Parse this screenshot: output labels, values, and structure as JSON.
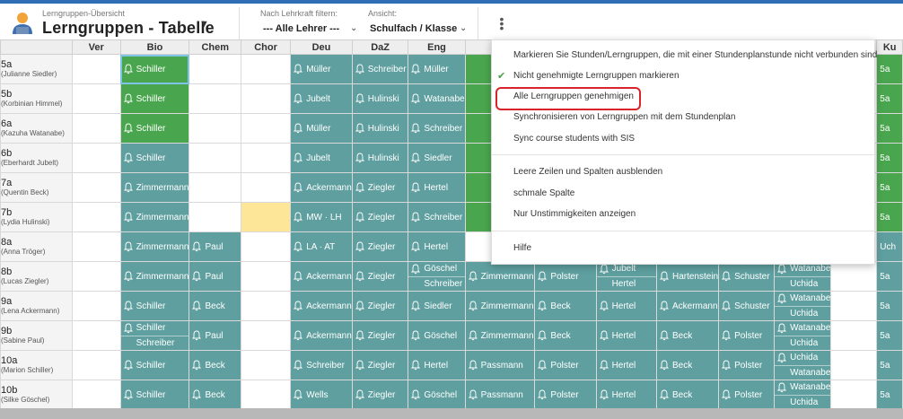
{
  "header": {
    "subtitle": "Lerngruppen-Übersicht",
    "title": "Lerngruppen - Tabelle",
    "filter_teacher_label": "Nach Lehrkraft filtern:",
    "filter_teacher_value": "--- Alle Lehrer ---",
    "view_label": "Ansicht:",
    "view_value": "Schulfach / Klasse"
  },
  "columns": [
    "",
    "Ver",
    "Bio",
    "Chem",
    "Chor",
    "Deu",
    "DaZ",
    "Eng",
    "",
    "",
    "",
    "",
    "",
    "",
    "",
    "Ku"
  ],
  "colors": {
    "teal": "#5f9f9f",
    "green": "#4aa64e",
    "yellow": "#fde698",
    "accent": "#2f6db5",
    "highlight": "#d9252a"
  },
  "rows": [
    {
      "cls": "5a",
      "teacher": "(Julianne Siedler)"
    },
    {
      "cls": "5b",
      "teacher": "(Korbinian Himmel)"
    },
    {
      "cls": "6a",
      "teacher": "(Kazuha Watanabe)"
    },
    {
      "cls": "6b",
      "teacher": "(Eberhardt Jubelt)"
    },
    {
      "cls": "7a",
      "teacher": "(Quentin Beck)"
    },
    {
      "cls": "7b",
      "teacher": "(Lydia Hulinski)"
    },
    {
      "cls": "8a",
      "teacher": "(Anna Tröger)"
    },
    {
      "cls": "8b",
      "teacher": "(Lucas Ziegler)"
    },
    {
      "cls": "9a",
      "teacher": "(Lena Ackermann)"
    },
    {
      "cls": "9b",
      "teacher": "(Sabine Paul)"
    },
    {
      "cls": "10a",
      "teacher": "(Marion Schiller)"
    },
    {
      "cls": "10b",
      "teacher": "(Silke Göschel)"
    }
  ],
  "cells": {
    "r0": {
      "bio": "Schiller",
      "deu": "Müller",
      "daz": "Schreiber",
      "eng": "Müller",
      "ku": "5a"
    },
    "r1": {
      "bio": "Schiller",
      "deu": "Jubelt",
      "daz": "Hulinski",
      "eng": "Watanabe",
      "ku": "5a"
    },
    "r2": {
      "bio": "Schiller",
      "deu": "Müller",
      "daz": "Hulinski",
      "eng": "Schreiber",
      "ku": "5a"
    },
    "r3": {
      "bio": "Schiller",
      "deu": "Jubelt",
      "daz": "Hulinski",
      "eng": "Siedler",
      "ku": "5a"
    },
    "r4": {
      "bio": "Zimmermann",
      "deu": "Ackermann",
      "daz": "Ziegler",
      "eng": "Hertel",
      "ku": "5a"
    },
    "r5": {
      "bio": "Zimmermann",
      "deu": "MW · LH",
      "daz": "Ziegler",
      "eng": "Schreiber",
      "ku": "5a"
    },
    "r6": {
      "bio": "Zimmermann",
      "chem": "Paul",
      "deu": "LA · AT",
      "daz": "Ziegler",
      "eng": "Hertel",
      "ku": "Uch"
    },
    "r7": {
      "bio": "Zimmermann",
      "chem": "Paul",
      "deu": "Ackermann",
      "daz": "Ziegler",
      "eng1": "Göschel",
      "eng2": "Schreiber",
      "c9": "Zimmermann",
      "c10": "Polster",
      "c11a": "Jubelt",
      "c11b": "Hertel",
      "c12": "Hartenstein",
      "c13": "Schuster",
      "c14a": "Watanabe",
      "c14b": "Uchida",
      "ku": "5a"
    },
    "r8": {
      "bio": "Schiller",
      "chem": "Beck",
      "deu": "Ackermann",
      "daz": "Ziegler",
      "eng": "Siedler",
      "c9": "Zimmermann",
      "c10": "Beck",
      "c11": "Hertel",
      "c12": "Ackermann",
      "c13": "Schuster",
      "c14a": "Watanabe",
      "c14b": "Uchida",
      "ku": "5a"
    },
    "r9": {
      "bio1": "Schiller",
      "bio2": "Schreiber",
      "chem": "Paul",
      "deu": "Ackermann",
      "daz": "Ziegler",
      "eng": "Göschel",
      "c9": "Zimmermann",
      "c10": "Beck",
      "c11": "Hertel",
      "c12": "Beck",
      "c13": "Polster",
      "c14a": "Watanabe",
      "c14b": "Uchida",
      "ku": "5a"
    },
    "r10": {
      "bio": "Schiller",
      "chem": "Beck",
      "deu": "Schreiber",
      "daz": "Ziegler",
      "eng": "Hertel",
      "c9": "Passmann",
      "c10": "Polster",
      "c11": "Hertel",
      "c12": "Beck",
      "c13": "Polster",
      "c14a": "Uchida",
      "c14b": "Watanabe",
      "ku": "5a"
    },
    "r11": {
      "bio": "Schiller",
      "chem": "Beck",
      "deu": "Wells",
      "daz": "Ziegler",
      "eng": "Göschel",
      "c9": "Passmann",
      "c10": "Polster",
      "c11": "Hertel",
      "c12": "Beck",
      "c13": "Polster",
      "c14a": "Watanabe",
      "c14b": "Uchida",
      "ku": "5a"
    }
  },
  "menu": {
    "item1": "Markieren Sie Stunden/Lerngruppen, die mit einer Stundenplanstunde nicht verbunden sind",
    "item2": "Nicht genehmigte Lerngruppen markieren",
    "item3": "Alle Lerngruppen genehmigen",
    "item4": "Synchronisieren von Lerngruppen mit dem Stundenplan",
    "item5": "Sync course students with SIS",
    "item6": "Leere Zeilen und Spalten ausblenden",
    "item7": "schmale Spalte",
    "item8": "Nur Unstimmigkeiten anzeigen",
    "item9": "Hilfe"
  }
}
